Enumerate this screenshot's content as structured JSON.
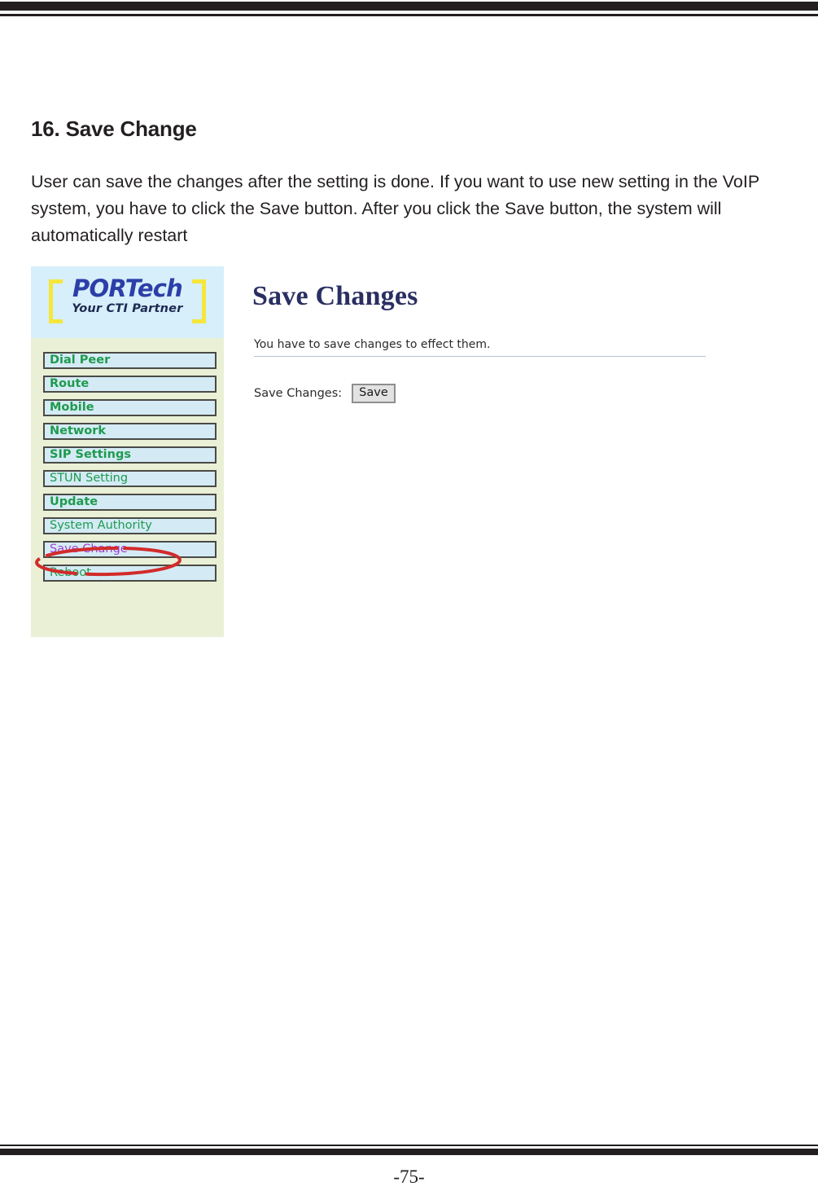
{
  "page": {
    "heading": "16. Save Change",
    "body": "User can save the changes after the setting is done. If you want to use new setting in the VoIP system, you have to click the Save button. After you click the Save button, the system will automatically restart",
    "page_number": "-75-"
  },
  "screenshot": {
    "logo": {
      "name_part1": "POR",
      "name_part2": "T",
      "name_part3": "ech",
      "full_name": "PORTech",
      "tagline": "Your CTI Partner",
      "brand_color": "#2c3ea8",
      "bracket_color": "#f5e63c",
      "band_color": "#d6effa"
    },
    "sidebar": {
      "background_color": "#e9f0d6",
      "item_color": "#1f9a4d",
      "visited_color": "#a33fd1",
      "items": [
        {
          "label": "Dial Peer",
          "style": "bold"
        },
        {
          "label": "Route",
          "style": "bold"
        },
        {
          "label": "Mobile",
          "style": "bold"
        },
        {
          "label": "Network",
          "style": "bold"
        },
        {
          "label": "SIP Settings",
          "style": "bold"
        },
        {
          "label": "STUN Setting",
          "style": "normal"
        },
        {
          "label": "Update",
          "style": "bold"
        },
        {
          "label": "System Authority",
          "style": "normal"
        },
        {
          "label": "Save Change",
          "style": "visited"
        },
        {
          "label": "Reboot",
          "style": "normal"
        }
      ]
    },
    "annotation": {
      "shape": "ellipse",
      "color": "#d22b2b",
      "target": "Save Change"
    },
    "main": {
      "title": "Save Changes",
      "note": "You have to save changes to effect them.",
      "form_label": "Save Changes:",
      "save_button": "Save"
    }
  }
}
